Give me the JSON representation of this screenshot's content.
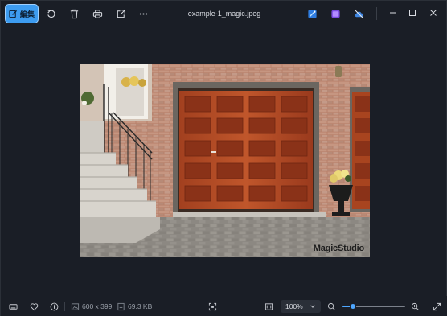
{
  "toolbar": {
    "edit_label": "編集",
    "file_name": "example-1_magic.jpeg"
  },
  "photo": {
    "watermark": "MagicStudio"
  },
  "statusbar": {
    "dimensions": "600 x 399",
    "file_size": "69.3 KB",
    "zoom": "100%",
    "zoom_level": 0.17
  },
  "icons": {
    "edit": "edit-icon",
    "rotate": "rotate-icon",
    "delete": "trash-icon",
    "print": "print-icon",
    "share": "share-icon",
    "more": "more-icon",
    "app1": "designer-icon",
    "app2": "clipchamp-icon",
    "cloud": "cloud-off-icon"
  },
  "colors": {
    "accent": "#3d9cf0",
    "background": "#1a1e26",
    "slider": "#4ea7ff"
  }
}
